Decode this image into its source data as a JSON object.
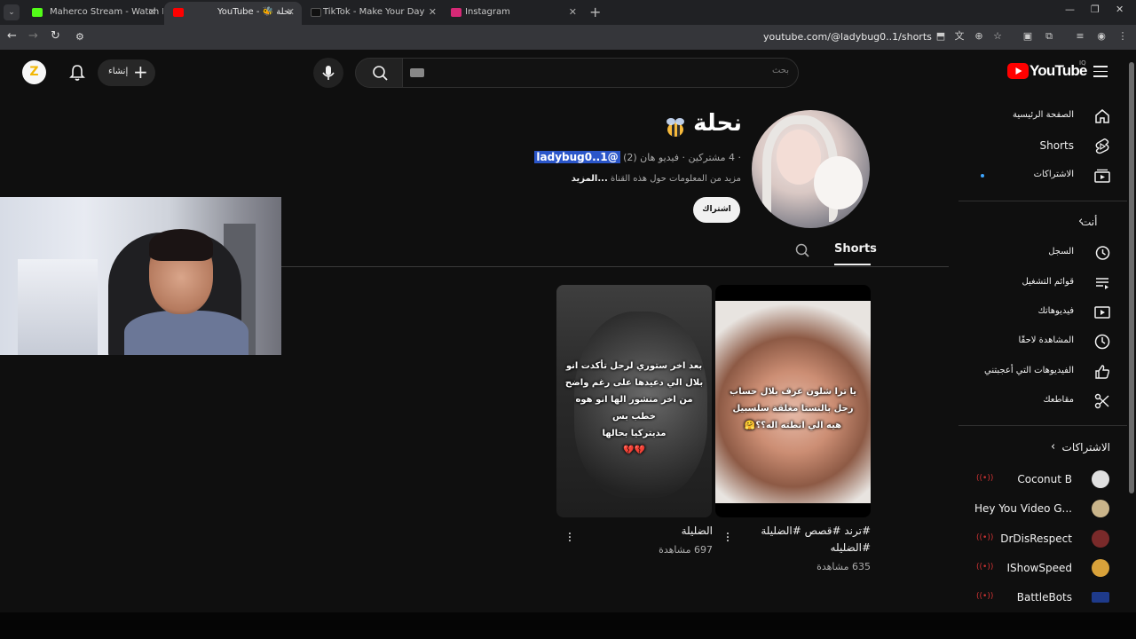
{
  "browser": {
    "tabs": [
      {
        "title": "Maherco Stream - Watch Live o",
        "favicon_color": "#53fc18"
      },
      {
        "title": "YouTube - 🐝 نحلة",
        "favicon_color": "#ff0000"
      },
      {
        "title": "TikTok - Make Your Day",
        "favicon_color": "#111111"
      },
      {
        "title": "Instagram",
        "favicon_color": "#d62976"
      }
    ],
    "url": "youtube.com/@ladybug0..1/shorts"
  },
  "header": {
    "create_label": "إنشاء",
    "search_placeholder": "بحث",
    "logo_text": "YouTube",
    "country_code": "IQ",
    "user_initial": "Z"
  },
  "channel": {
    "name": "نحلة",
    "handle": "@ladybug0..1",
    "stats": "· 4 مشتركين · فيديو هان (2)",
    "about": "مزيد من المعلومات حول هذه القناة",
    "about_more": "...المزيد",
    "subscribe_label": "اشتراك",
    "tab": "Shorts"
  },
  "shorts": [
    {
      "title_line1": "الضليلة",
      "title_line2": "",
      "views": "697 مشاهدة",
      "overlay": [
        "بعد اخر ستوري لرحل تأكدت انو",
        "بلال الي دعيدها على رغم واضح",
        "من اخر منشور الها انو هوه خطب بس",
        "مديتركيا بحالها",
        "💔💔"
      ]
    },
    {
      "title_line1": "#ترند #قصص #الضليلة",
      "title_line2": "#الضليله",
      "views": "635 مشاهدة",
      "overlay": [
        "يا ترا شلون عرف بلال حساب",
        "رحل بالنستا مغلقة سلسبيل",
        "هيه الي انطته اله؟؟🤗"
      ]
    }
  ],
  "guide": {
    "main": [
      {
        "label": "الصفحة الرئيسية",
        "icon": "home-icon"
      },
      {
        "label": "Shorts",
        "icon": "shorts-icon"
      },
      {
        "label": "الاشتراكات",
        "icon": "subscriptions-icon"
      }
    ],
    "you_header": "أنت",
    "you": [
      {
        "label": "السجل",
        "icon": "history-icon"
      },
      {
        "label": "قوائم التشغيل",
        "icon": "playlists-icon"
      },
      {
        "label": "فيديوهاتك",
        "icon": "your-videos-icon"
      },
      {
        "label": "المشاهدة لاحقًا",
        "icon": "watch-later-icon"
      },
      {
        "label": "الفيديوهات التي أعجبتني",
        "icon": "liked-icon"
      },
      {
        "label": "مقاطعك",
        "icon": "clips-icon"
      }
    ],
    "subs_header": "الاشتراكات",
    "subscriptions": [
      {
        "name": "Coconut B",
        "avatar_color": "#e0e0e0"
      },
      {
        "name": "Hey You Video G...",
        "avatar_color": "#c9b48a"
      },
      {
        "name": "DrDisRespect",
        "avatar_color": "#7a2a2a"
      },
      {
        "name": "IShowSpeed",
        "avatar_color": "#d9a23a"
      },
      {
        "name": "BattleBots",
        "avatar_color": "#1e3a8a"
      }
    ]
  },
  "colors": {
    "accent": "#3ea6ff",
    "brand_red": "#ff0000",
    "background": "#0f0f0f"
  }
}
